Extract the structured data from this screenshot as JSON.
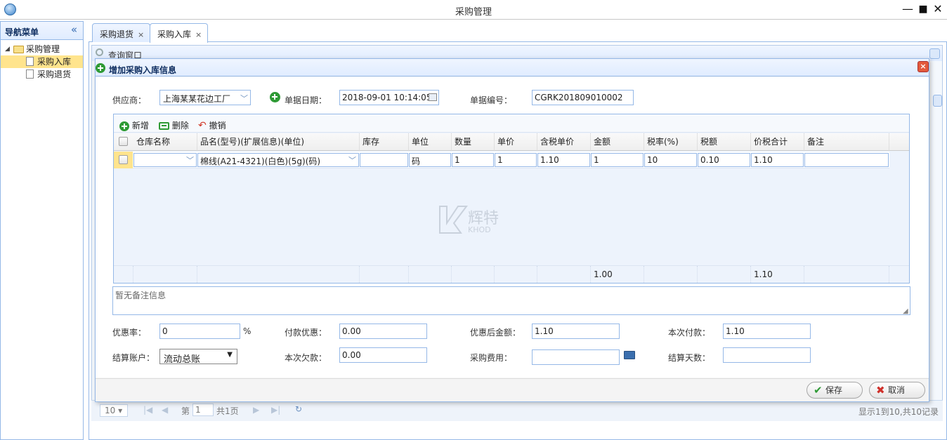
{
  "window": {
    "title": "采购管理",
    "minimize": "—",
    "maximize": "■",
    "close": "✕"
  },
  "nav": {
    "title": "导航菜单",
    "collapse": "«",
    "tree": {
      "root": "采购管理",
      "items": [
        {
          "label": "采购入库",
          "selected": true
        },
        {
          "label": "采购退货",
          "selected": false
        }
      ]
    }
  },
  "tabs": [
    {
      "label": "采购退货",
      "close": "×",
      "active": false
    },
    {
      "label": "采购入库",
      "close": "×",
      "active": true
    }
  ],
  "background": {
    "query_title": "查询窗口",
    "pager": {
      "page_size": "10",
      "page_prefix": "第",
      "page": "1",
      "page_total": "共1页",
      "summary": "显示1到10,共10记录"
    }
  },
  "dialog": {
    "title": "增加采购入库信息",
    "close": "×",
    "form": {
      "supplier_label": "供应商：",
      "supplier_value": "上海某某花边工厂",
      "date_label": "单据日期：",
      "date_value": "2018-09-01 10:14:05",
      "number_label": "单据编号：",
      "number_value": "CGRK201809010002"
    },
    "toolbar": {
      "add": "新增",
      "delete": "删除",
      "undo": "撤销"
    },
    "grid": {
      "columns": [
        "仓库名称",
        "品名(型号)(扩展信息)(单位)",
        "库存",
        "单位",
        "数量",
        "单价",
        "含税单价",
        "金额",
        "税率(%)",
        "税额",
        "价税合计",
        "备注"
      ],
      "row": {
        "warehouse": "",
        "product": "棉线(A21-4321)(白色)(5g)(码)",
        "stock": "",
        "unit": "码",
        "qty": "1",
        "price": "1",
        "tax_price": "1.10",
        "amount": "1",
        "tax_rate": "10",
        "tax": "0.10",
        "total": "1.10",
        "note": ""
      },
      "footer": {
        "amount": "1.00",
        "total": "1.10"
      }
    },
    "remark_placeholder": "暂无备注信息",
    "summary": {
      "discount_rate_label": "优惠率：",
      "discount_rate_value": "0",
      "percent": "%",
      "pay_discount_label": "付款优惠：",
      "pay_discount_value": "0.00",
      "after_discount_label": "优惠后金额：",
      "after_discount_value": "1.10",
      "this_payment_label": "本次付款：",
      "this_payment_value": "1.10",
      "account_label": "结算账户：",
      "account_value": "流动总账",
      "arrears_label": "本次欠款：",
      "arrears_value": "0.00",
      "fee_label": "采购费用：",
      "fee_value": "",
      "days_label": "结算天数：",
      "days_value": ""
    },
    "buttons": {
      "save": "保存",
      "cancel": "取消"
    }
  },
  "watermark": {
    "text_cn": "辉特",
    "text_en": "KHOD"
  },
  "colors": {
    "border": "#95b8e7",
    "header": "#e0ecff",
    "selected": "#ffe48d",
    "add_green": "#2e9a35",
    "close_red": "#e3593c"
  }
}
